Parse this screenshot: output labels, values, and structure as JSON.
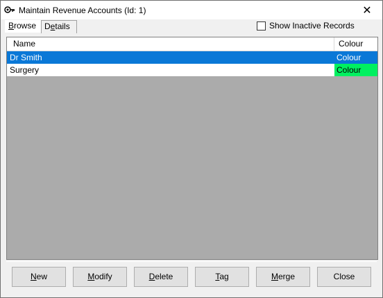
{
  "window": {
    "title": "Maintain Revenue Accounts (Id: 1)",
    "close_glyph": "✕"
  },
  "tabs": [
    {
      "label_prefix": "",
      "label_underline": "B",
      "label_rest": "rowse"
    },
    {
      "label_prefix": "D",
      "label_underline": "e",
      "label_rest": "tails"
    }
  ],
  "show_inactive": {
    "label": "Show Inactive Records",
    "checked": false
  },
  "grid": {
    "columns": [
      "Name",
      "Colour"
    ],
    "rows": [
      {
        "name": "Dr Smith",
        "colour": "Colour",
        "selected": true,
        "swatch": "#0a78d7"
      },
      {
        "name": "Surgery",
        "colour": "Colour",
        "selected": false,
        "swatch": "#00f060"
      }
    ]
  },
  "buttons": [
    {
      "u": "N",
      "rest": "ew"
    },
    {
      "u": "M",
      "rest": "odify"
    },
    {
      "u": "D",
      "rest": "elete"
    },
    {
      "u": "T",
      "rest": "ag"
    },
    {
      "u": "M",
      "rest": "erge",
      "pre": ""
    },
    {
      "u": "",
      "rest": "Close"
    }
  ],
  "colors": {
    "selection": "#0a78d7",
    "surgery_colour": "#00f060"
  }
}
